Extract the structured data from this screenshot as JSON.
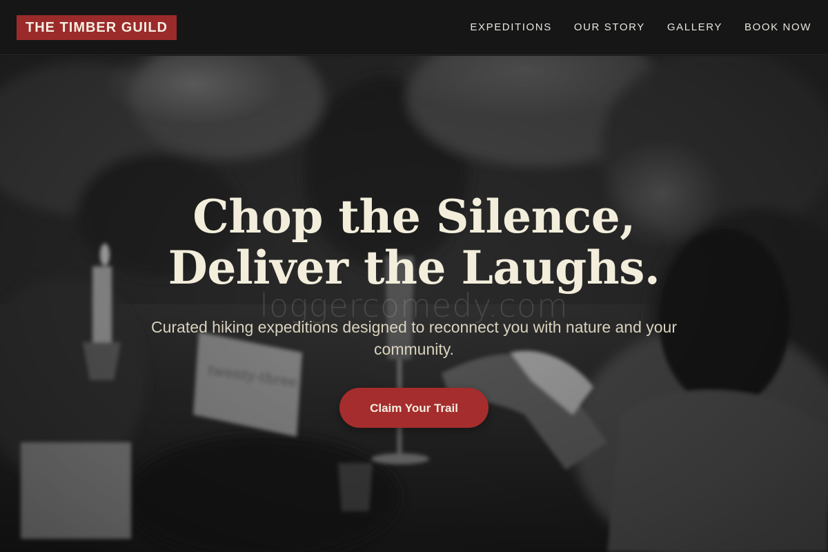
{
  "brand": {
    "logo_text": "THE TIMBER GUILD",
    "accent_color": "#9b2a2a"
  },
  "nav": {
    "items": [
      {
        "label": "EXPEDITIONS"
      },
      {
        "label": "OUR STORY"
      },
      {
        "label": "GALLERY"
      },
      {
        "label": "BOOK NOW"
      }
    ]
  },
  "hero": {
    "title": "Chop the Silence, Deliver the Laughs.",
    "subtitle": "Curated hiking expeditions designed to reconnect you with nature and your community.",
    "cta_label": "Claim Your Trail",
    "watermark": "loggercomedy.com",
    "background_image": "black-and-white photo of guests raising glasses at a candlelit banquet"
  }
}
